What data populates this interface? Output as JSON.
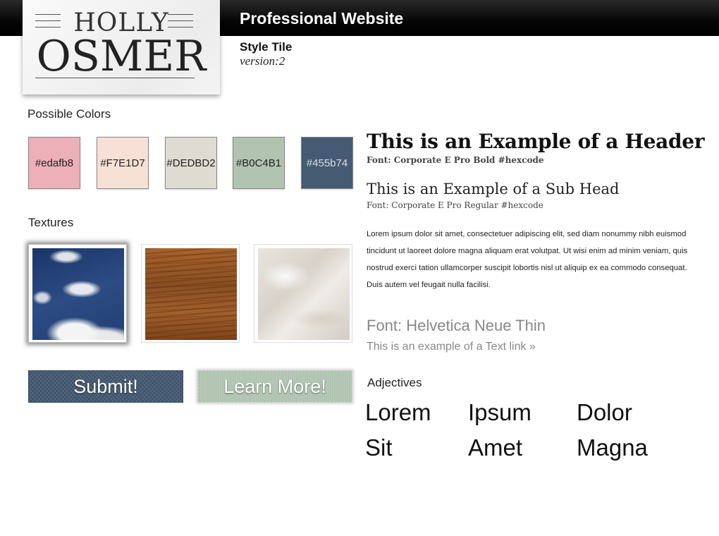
{
  "header": {
    "title": "Professional Website",
    "subtitle": "Style Tile",
    "version": "version:2"
  },
  "logo": {
    "first": "HOLLY",
    "last": "OSMER"
  },
  "colors": {
    "label": "Possible Colors",
    "swatches": [
      {
        "code": "#edafb8",
        "hex": "#edafb8",
        "text_color": "#222222"
      },
      {
        "code": "#F7E1D7",
        "hex": "#F7E1D7",
        "text_color": "#222222"
      },
      {
        "code": "#DEDBD2",
        "hex": "#DEDBD2",
        "text_color": "#222222"
      },
      {
        "code": "#B0C4B1",
        "hex": "#B0C4B1",
        "text_color": "#222222"
      },
      {
        "code": "#455b74",
        "hex": "#455b74",
        "text_color": "#d9dde3"
      }
    ]
  },
  "textures": {
    "label": "Textures",
    "items": [
      "sky-clouds",
      "wood-grain",
      "marble"
    ]
  },
  "buttons": {
    "submit": "Submit!",
    "learn_more": "Learn More!"
  },
  "typography": {
    "header": "This is an Example of a Header",
    "header_note": "Font: Corporate E Pro Bold #hexcode",
    "subhead": "This is an Example of a Sub Head",
    "subhead_note": "Font: Corporate E Pro Regular #hexcode",
    "body": "Lorem ipsum dolor sit amet, consectetuer adipiscing elit, sed diam nonummy nibh euismod tincidunt ut laoreet dolore magna aliquam erat volutpat. Ut wisi enim ad minim veniam, quis nostrud exerci tation ullamcorper suscipit lobortis nisl ut aliquip ex ea commodo consequat. Duis autem vel feugait nulla facilisi.",
    "thin_font": "Font: Helvetica Neue Thin",
    "text_link": "This is an example of a Text link »"
  },
  "adjectives": {
    "label": "Adjectives",
    "words": [
      "Lorem",
      "Ipsum",
      "Dolor",
      "Sit",
      "Amet",
      "Magna"
    ]
  }
}
